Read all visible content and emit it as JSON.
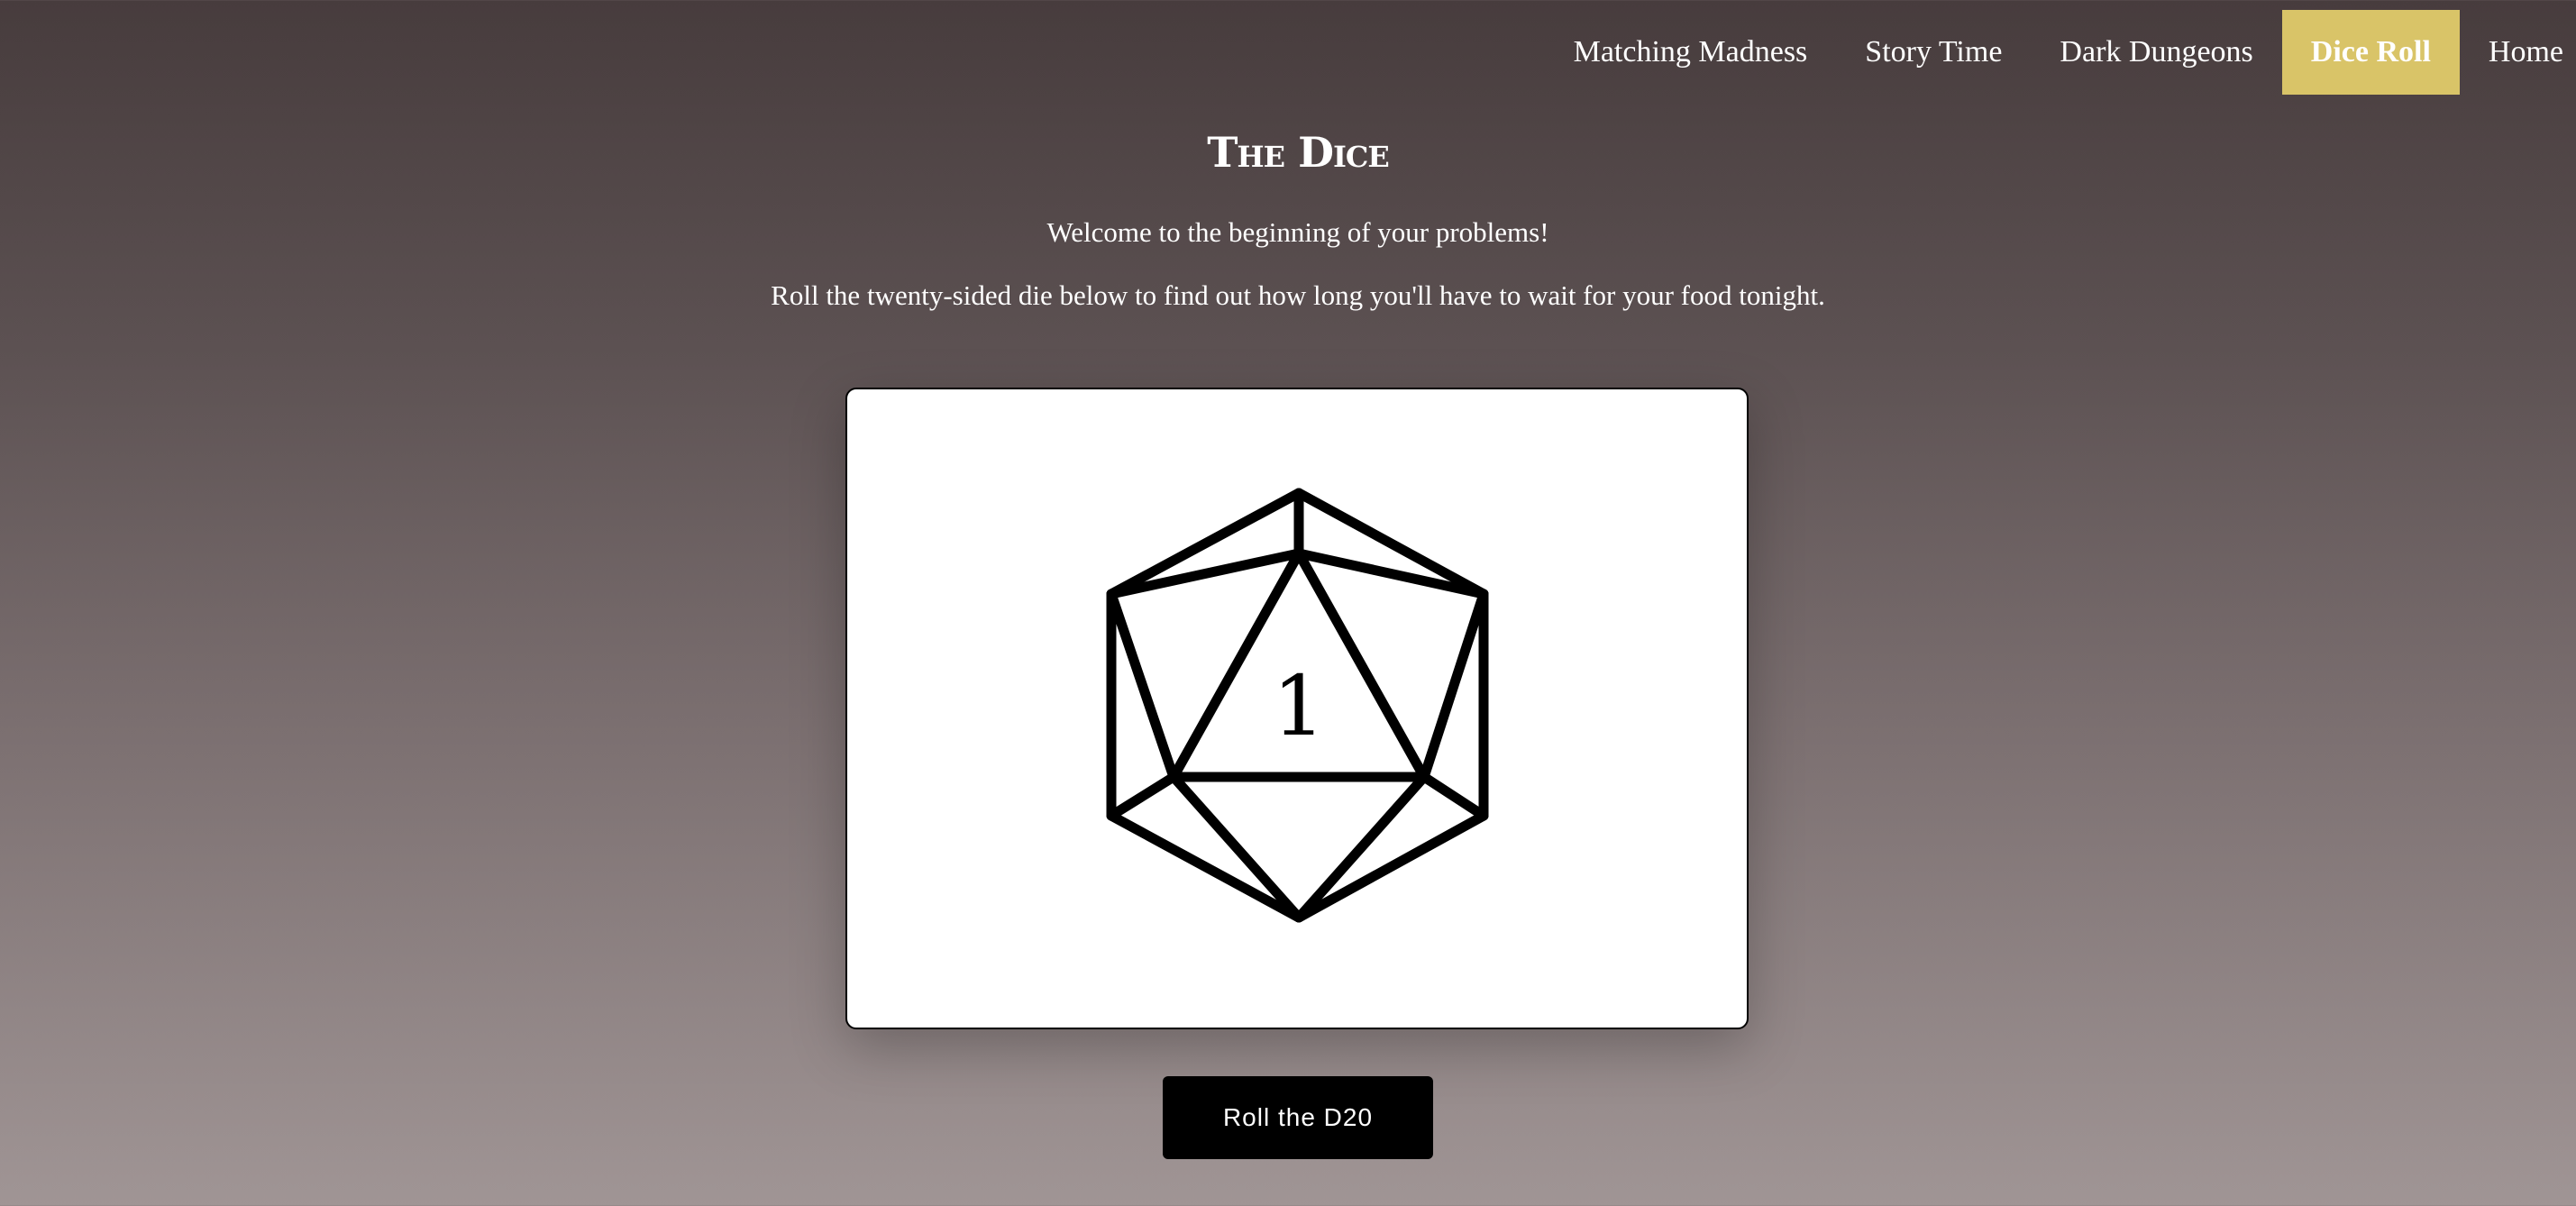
{
  "nav": {
    "items": [
      {
        "label": "Matching Madness",
        "active": false
      },
      {
        "label": "Story Time",
        "active": false
      },
      {
        "label": "Dark Dungeons",
        "active": false
      },
      {
        "label": "Dice Roll",
        "active": true
      },
      {
        "label": "Home",
        "active": false
      }
    ],
    "active_color": "#d9c468"
  },
  "main": {
    "title": "The Dice",
    "welcome": "Welcome to the beginning of your problems!",
    "instructions": "Roll the twenty-sided die below to find out how long you'll have to wait for your food tonight."
  },
  "die": {
    "icon": "d20-icon",
    "value": "1"
  },
  "roll_button": {
    "label": "Roll the D20"
  }
}
